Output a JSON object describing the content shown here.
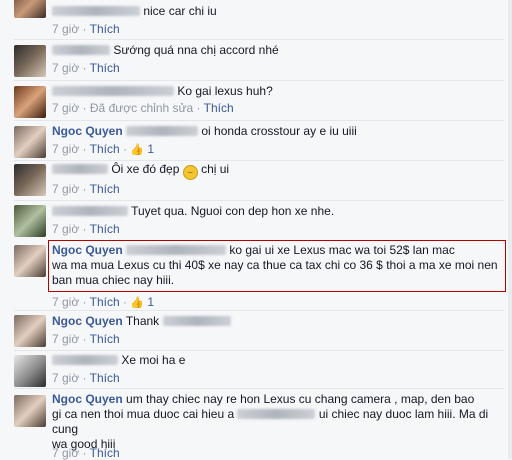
{
  "comments": [
    {
      "name": "",
      "text": "nice car chi iu",
      "time": "7 giờ",
      "like": "Thích"
    },
    {
      "name": "",
      "text": "Sướng quá nna chị accord nhé",
      "time": "7 giờ",
      "like": "Thích"
    },
    {
      "name": "",
      "text": "Ko gai lexus huh?",
      "time": "7 giờ",
      "edited": "Đã được chỉnh sửa",
      "like": "Thích"
    },
    {
      "name": "Ngoc Quyen",
      "text": "oi honda crosstour ay e iu uiii",
      "time": "7 giờ",
      "like": "Thích",
      "like_count": "1"
    },
    {
      "name": "",
      "text_before": "Ôi xe đó đẹp",
      "text_after": "chị ui",
      "emoji": "smile-emoji",
      "time": "7 giờ",
      "like": "Thích"
    },
    {
      "name": "",
      "text": "Tuyet qua. Nguoi con dep hon xe nhe.",
      "time": "7 giờ",
      "like": "Thích"
    },
    {
      "name": "Ngoc Quyen",
      "text_lines": [
        "ko gai ui xe Lexus mac wa toi 52$ lan mac",
        "wa ma mua Lexus cu thi 40$ xe nay ca thue ca tax chi co 36 $ thoi a ma xe moi nen",
        "ban mua chiec nay hiii."
      ],
      "time": "7 giờ",
      "like": "Thích",
      "like_count": "1"
    },
    {
      "name": "Ngoc Quyen",
      "text": "Thank",
      "time": "7 giờ",
      "like": "Thích"
    },
    {
      "name": "",
      "text": "Xe moi ha e",
      "time": "7 giờ",
      "like": "Thích"
    },
    {
      "name": "Ngoc Quyen",
      "text_lines": [
        "um thay chiec nay re hon Lexus cu chang camera , map, den bao",
        "gi ca nen thoi mua duoc cai hieu a",
        "ui chiec nay duoc lam hiii. Ma di cung",
        "wa good hiii"
      ],
      "time": "7 giờ",
      "like": "Thích"
    }
  ],
  "colors": {
    "name": "#3b5998",
    "meta": "#9197a3",
    "highlight": "#b30000"
  }
}
